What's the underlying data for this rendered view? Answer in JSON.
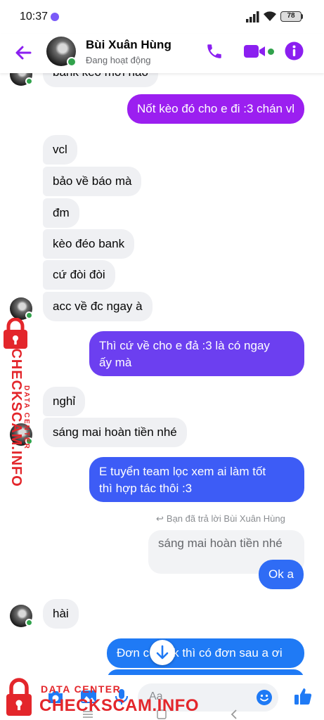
{
  "status_bar": {
    "time": "10:37",
    "battery": "78"
  },
  "header": {
    "contact_name": "Bùi Xuân Hùng",
    "contact_status": "Đang hoạt động"
  },
  "messages": [
    {
      "side": "in",
      "text": "bank kèo mới nào"
    },
    {
      "side": "out",
      "text": "Nốt kèo đó cho e đi :3 chán vl"
    },
    {
      "side": "in",
      "text": "vcl"
    },
    {
      "side": "in",
      "text": "bảo về báo mà"
    },
    {
      "side": "in",
      "text": "đm"
    },
    {
      "side": "in",
      "text": "kèo đéo bank"
    },
    {
      "side": "in",
      "text": "cứ đòi đòi"
    },
    {
      "side": "in",
      "text": "acc về đc ngay à"
    },
    {
      "side": "out",
      "text": "Thì cứ về cho e đả :3 là có ngay",
      "text2": "ấy mà"
    },
    {
      "side": "in",
      "text": "nghỉ"
    },
    {
      "side": "in",
      "text": "sáng mai hoàn tiền nhé"
    },
    {
      "side": "out",
      "text": "E tuyển team lọc xem ai làm tốt",
      "text2": "thì hợp tác thôi :3"
    },
    {
      "side": "out",
      "text": "Ok a"
    },
    {
      "side": "in",
      "text": "hài"
    },
    {
      "side": "out",
      "text": "Đơn c",
      "text_tail": "k thì có đơn sau a ơi"
    }
  ],
  "reply": {
    "note": "Bạn đã trả lời Bùi Xuân Hùng",
    "quoted_text": "sáng mai hoàn tiền nhé"
  },
  "composer": {
    "placeholder": "Aa"
  },
  "watermark": {
    "small": "DATA CENTER",
    "brand": "CHECKSCAM.INFO"
  },
  "colors": {
    "accent": "#8b1ff0",
    "bubble_purple": "#9b1ff0",
    "bubble_violet": "#6c3ff0",
    "bubble_blue": "#3d5cf6",
    "bubble_blue2": "#1f7af5",
    "online": "#31a24c",
    "watermark_red": "#e3262b"
  },
  "icons": [
    "back-arrow-icon",
    "phone-icon",
    "video-camera-icon",
    "info-icon",
    "chevron-down-icon",
    "camera-icon",
    "image-icon",
    "microphone-icon",
    "emoji-icon",
    "thumbs-up-icon",
    "lock-icon"
  ]
}
